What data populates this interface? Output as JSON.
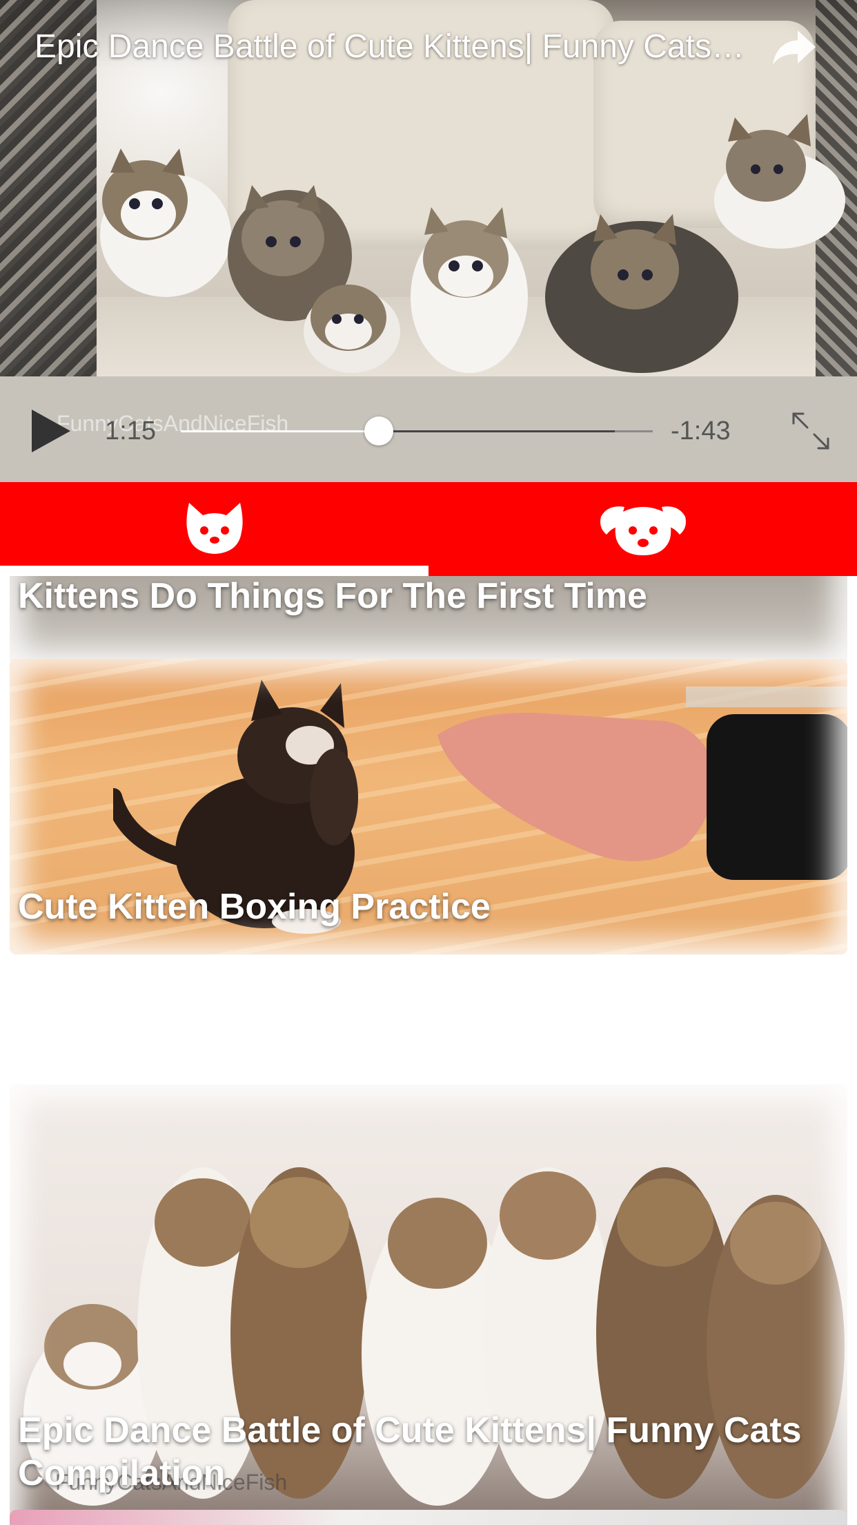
{
  "player": {
    "title": "Epic Dance Battle of Cute Kittens| Funny Cats Compilation",
    "watermark": "FunnyCatsAndNiceFish",
    "time_elapsed": "1:15",
    "time_remaining": "-1:43",
    "progress_fraction": 0.42,
    "buffered_fraction": 0.92,
    "icons": {
      "share": "share-arrow-icon",
      "play": "play-icon",
      "fullscreen": "fullscreen-expand-icon"
    }
  },
  "tabs": {
    "items": [
      {
        "id": "cats",
        "icon": "cat-face-icon",
        "selected": true
      },
      {
        "id": "dogs",
        "icon": "dog-face-icon",
        "selected": false
      }
    ],
    "bar_color": "#fe0000",
    "indicator_color": "#ffffff"
  },
  "feed": {
    "videos": [
      {
        "title": "Kittens Do Things For The First Time"
      },
      {
        "title": "Cute Kitten Boxing Practice"
      },
      {
        "title": "Epic Dance Battle of Cute Kittens| Funny Cats Compilation",
        "watermark": "FunnyCatsAndNiceFish"
      }
    ]
  }
}
